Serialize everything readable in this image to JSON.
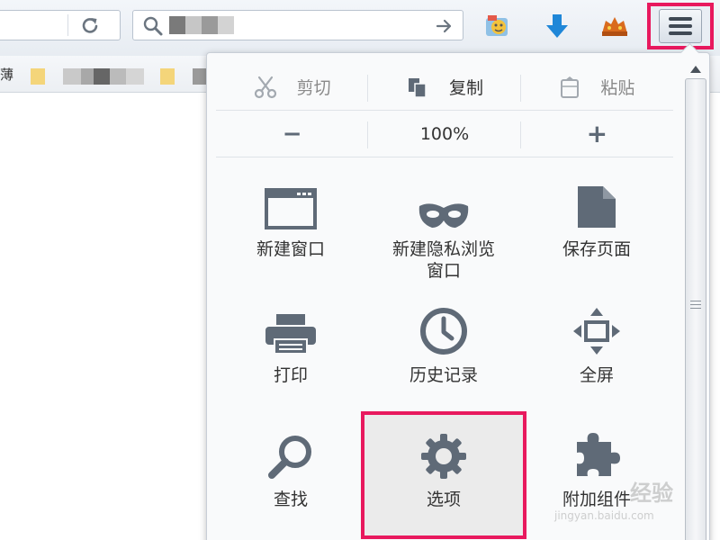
{
  "toolbar": {
    "search": {
      "query": ""
    },
    "icons": [
      "reload-icon",
      "search-icon",
      "go-arrow-icon",
      "sync-icon",
      "download-icon",
      "extension-icon",
      "menu-icon"
    ]
  },
  "bookmarks": {
    "first_char": "薄"
  },
  "menu": {
    "edit": {
      "cut": "剪切",
      "copy": "复制",
      "paste": "粘贴"
    },
    "zoom": {
      "minus": "−",
      "level": "100%",
      "plus": "+"
    },
    "items": [
      {
        "id": "new-window",
        "label": "新建窗口",
        "icon": "window-icon"
      },
      {
        "id": "private-window",
        "label_line1": "新建隐私浏览",
        "label_line2": "窗口",
        "icon": "mask-icon"
      },
      {
        "id": "save-page",
        "label": "保存页面",
        "icon": "page-icon"
      },
      {
        "id": "print",
        "label": "打印",
        "icon": "printer-icon"
      },
      {
        "id": "history",
        "label": "历史记录",
        "icon": "clock-icon"
      },
      {
        "id": "fullscreen",
        "label": "全屏",
        "icon": "fullscreen-icon"
      },
      {
        "id": "find",
        "label": "查找",
        "icon": "magnifier-icon"
      },
      {
        "id": "options",
        "label": "选项",
        "icon": "gear-icon"
      },
      {
        "id": "addons",
        "label": "附加组件",
        "icon": "puzzle-icon"
      }
    ]
  },
  "watermark": {
    "main": "经验",
    "sub": "jingyan.baidu.com"
  },
  "colors": {
    "highlight": "#e8195e",
    "icon": "#5f6a77"
  }
}
